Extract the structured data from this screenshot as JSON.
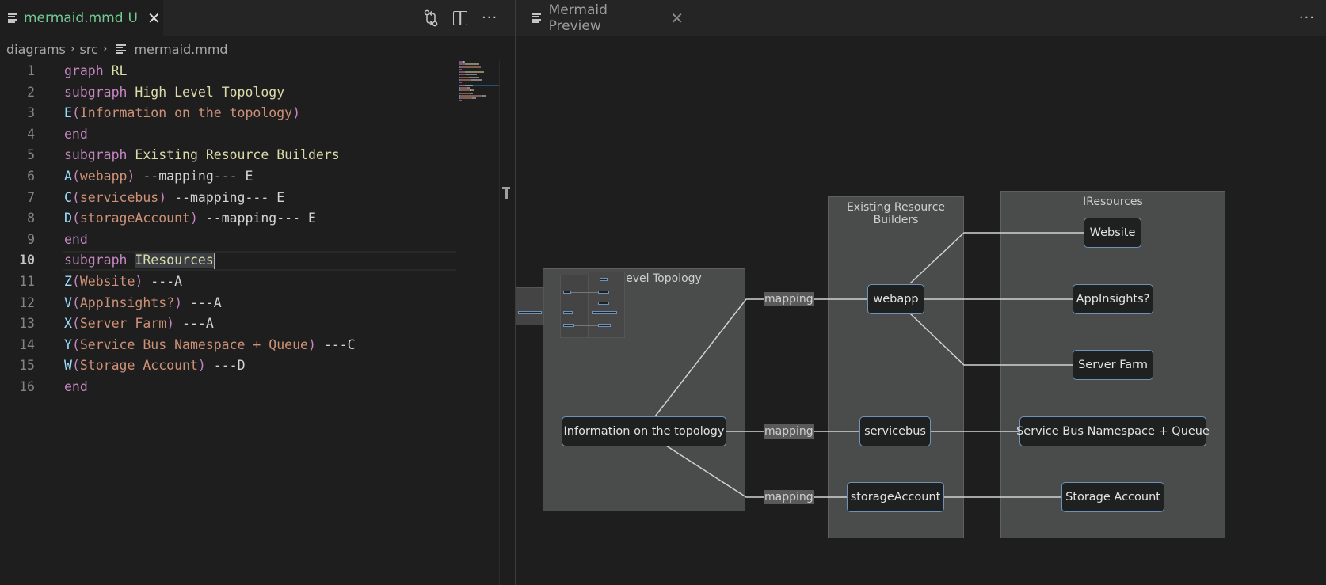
{
  "editor": {
    "tab": {
      "filename": "mermaid.mmd",
      "badge": "U",
      "close": "✕",
      "icon": "file-lines-icon"
    },
    "actions": [
      {
        "name": "open-changes-icon",
        "glyph": "⇅"
      },
      {
        "name": "split-editor-icon",
        "glyph": ""
      },
      {
        "name": "more-actions-icon",
        "glyph": "···"
      }
    ],
    "breadcrumb": [
      "diagrams",
      "src",
      "mermaid.mmd"
    ],
    "breadcrumb_sep": "›",
    "current_line": 10,
    "lines": [
      {
        "n": "1",
        "tokens": [
          [
            "kw",
            "graph"
          ],
          [
            "plain",
            " "
          ],
          [
            "ttl",
            "RL"
          ]
        ]
      },
      {
        "n": "2",
        "tokens": [
          [
            "kw",
            "subgraph"
          ],
          [
            "plain",
            " "
          ],
          [
            "ttl",
            "High Level Topology"
          ]
        ]
      },
      {
        "n": "3",
        "tokens": [
          [
            "id",
            "E"
          ],
          [
            "kw",
            "("
          ],
          [
            "str",
            "Information on the topology"
          ],
          [
            "kw",
            ")"
          ]
        ]
      },
      {
        "n": "4",
        "tokens": [
          [
            "kw",
            "end"
          ]
        ]
      },
      {
        "n": "5",
        "tokens": [
          [
            "kw",
            "subgraph"
          ],
          [
            "plain",
            " "
          ],
          [
            "ttl",
            "Existing Resource Builders"
          ]
        ]
      },
      {
        "n": "6",
        "tokens": [
          [
            "id",
            "A"
          ],
          [
            "kw",
            "("
          ],
          [
            "str",
            "webapp"
          ],
          [
            "kw",
            ")"
          ],
          [
            "plain",
            " --mapping--- E"
          ]
        ]
      },
      {
        "n": "7",
        "tokens": [
          [
            "id",
            "C"
          ],
          [
            "kw",
            "("
          ],
          [
            "str",
            "servicebus"
          ],
          [
            "kw",
            ")"
          ],
          [
            "plain",
            " --mapping--- E"
          ]
        ]
      },
      {
        "n": "8",
        "tokens": [
          [
            "id",
            "D"
          ],
          [
            "kw",
            "("
          ],
          [
            "str",
            "storageAccount"
          ],
          [
            "kw",
            ")"
          ],
          [
            "plain",
            " --mapping--- E"
          ]
        ]
      },
      {
        "n": "9",
        "tokens": [
          [
            "kw",
            "end"
          ]
        ]
      },
      {
        "n": "10",
        "tokens": [
          [
            "kw",
            "subgraph"
          ],
          [
            "plain",
            " "
          ],
          [
            "ttl sel",
            "IResources"
          ]
        ]
      },
      {
        "n": "11",
        "tokens": [
          [
            "id",
            "Z"
          ],
          [
            "kw",
            "("
          ],
          [
            "str",
            "Website"
          ],
          [
            "kw",
            ")"
          ],
          [
            "plain",
            " ---A"
          ]
        ]
      },
      {
        "n": "12",
        "tokens": [
          [
            "id",
            "V"
          ],
          [
            "kw",
            "("
          ],
          [
            "str",
            "AppInsights?"
          ],
          [
            "kw",
            ")"
          ],
          [
            "plain",
            " ---A"
          ]
        ]
      },
      {
        "n": "13",
        "tokens": [
          [
            "id",
            "X"
          ],
          [
            "kw",
            "("
          ],
          [
            "str",
            "Server Farm"
          ],
          [
            "kw",
            ")"
          ],
          [
            "plain",
            " ---A"
          ]
        ]
      },
      {
        "n": "14",
        "tokens": [
          [
            "id",
            "Y"
          ],
          [
            "kw",
            "("
          ],
          [
            "str",
            "Service Bus Namespace + Queue"
          ],
          [
            "kw",
            ")"
          ],
          [
            "plain",
            " ---C"
          ]
        ]
      },
      {
        "n": "15",
        "tokens": [
          [
            "id",
            "W"
          ],
          [
            "kw",
            "("
          ],
          [
            "str",
            "Storage Account"
          ],
          [
            "kw",
            ")"
          ],
          [
            "plain",
            " ---D"
          ]
        ]
      },
      {
        "n": "16",
        "tokens": [
          [
            "kw",
            "end"
          ]
        ]
      }
    ]
  },
  "preview": {
    "tab": {
      "title": "Mermaid Preview",
      "close": "✕",
      "icon": "file-lines-icon"
    },
    "more": "···",
    "clusters": {
      "topology": "High Level Topology",
      "topology_visible": "evel Topology",
      "builders": "Existing Resource Builders",
      "resources": "IResources"
    },
    "nodes": {
      "E": "Information on the topology",
      "A": "webapp",
      "C": "servicebus",
      "D": "storageAccount",
      "Z": "Website",
      "V": "AppInsights?",
      "X": "Server Farm",
      "Y": "Service Bus Namespace + Queue",
      "W": "Storage Account"
    },
    "edge_label": "mapping",
    "edges": [
      {
        "from": "A",
        "to": "E",
        "label": "mapping"
      },
      {
        "from": "C",
        "to": "E",
        "label": "mapping"
      },
      {
        "from": "D",
        "to": "E",
        "label": "mapping"
      },
      {
        "from": "Z",
        "to": "A",
        "label": ""
      },
      {
        "from": "V",
        "to": "A",
        "label": ""
      },
      {
        "from": "X",
        "to": "A",
        "label": ""
      },
      {
        "from": "Y",
        "to": "C",
        "label": ""
      },
      {
        "from": "W",
        "to": "D",
        "label": ""
      }
    ],
    "colors": {
      "node_border": "#6d93bb",
      "node_fill": "#1f2020",
      "cluster_fill": "#4a4b4b",
      "edge": "#d3d3d3",
      "tab_modified": "#73c991"
    }
  }
}
